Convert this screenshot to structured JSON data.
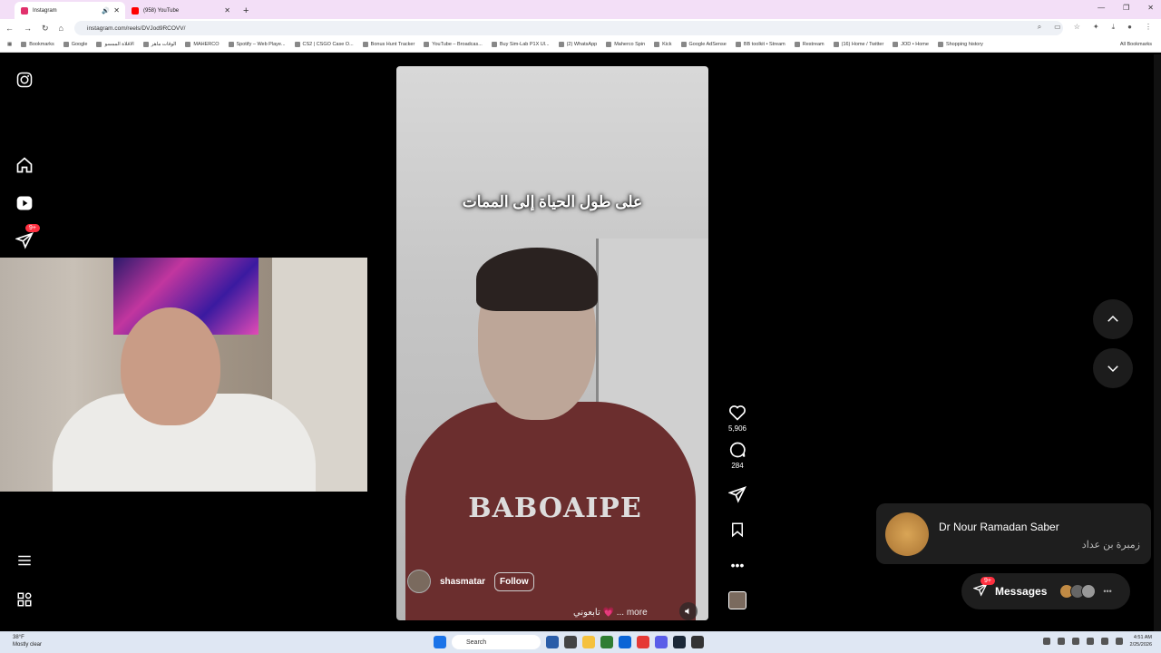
{
  "browser": {
    "tabs": [
      {
        "title": "Instagram",
        "active": true,
        "color": "#e1306c"
      },
      {
        "title": "(958) YouTube",
        "active": false,
        "color": "#ff0000"
      }
    ],
    "url": "instagram.com/reels/DVJod9RCOVV/",
    "bookmarks": [
      "Bookmarks",
      "Google",
      "الاقلاة الممسو",
      "الوقات ماهر",
      "MAHERCO",
      "Spotify – Web Playe...",
      "CS2 | CSGO Case O...",
      "Bonus Hunt Tracker",
      "YouTube – Broadcas...",
      "Buy Sim-Lab P1X Ul...",
      "(2) WhatsApp",
      "Maherco Spin",
      "Kick",
      "Google AdSense",
      "BB toolkit • Stream",
      "Restream",
      "(16) Home / Twitter",
      "JOD • Home",
      "Shopping history"
    ],
    "all_bookmarks": "All Bookmarks"
  },
  "sidebar": {
    "notification_badge": "9+"
  },
  "reel": {
    "caption": "على طول الحياة إلى الممات",
    "shirt_text": "BABOAIPE",
    "username": "shasmatar",
    "follow_label": "Follow",
    "description": "تابعوني 💗 ... more",
    "likes": "5,906",
    "comments": "284"
  },
  "notification": {
    "name": "Dr Nour Ramadan Saber",
    "message": "زمبرة بن عداد"
  },
  "messages": {
    "label": "Messages",
    "badge": "9+"
  },
  "taskbar": {
    "weather_temp": "38°F",
    "weather_desc": "Mostly clear",
    "search_label": "Search",
    "time": "4:51 AM",
    "date": "2/25/2026"
  }
}
